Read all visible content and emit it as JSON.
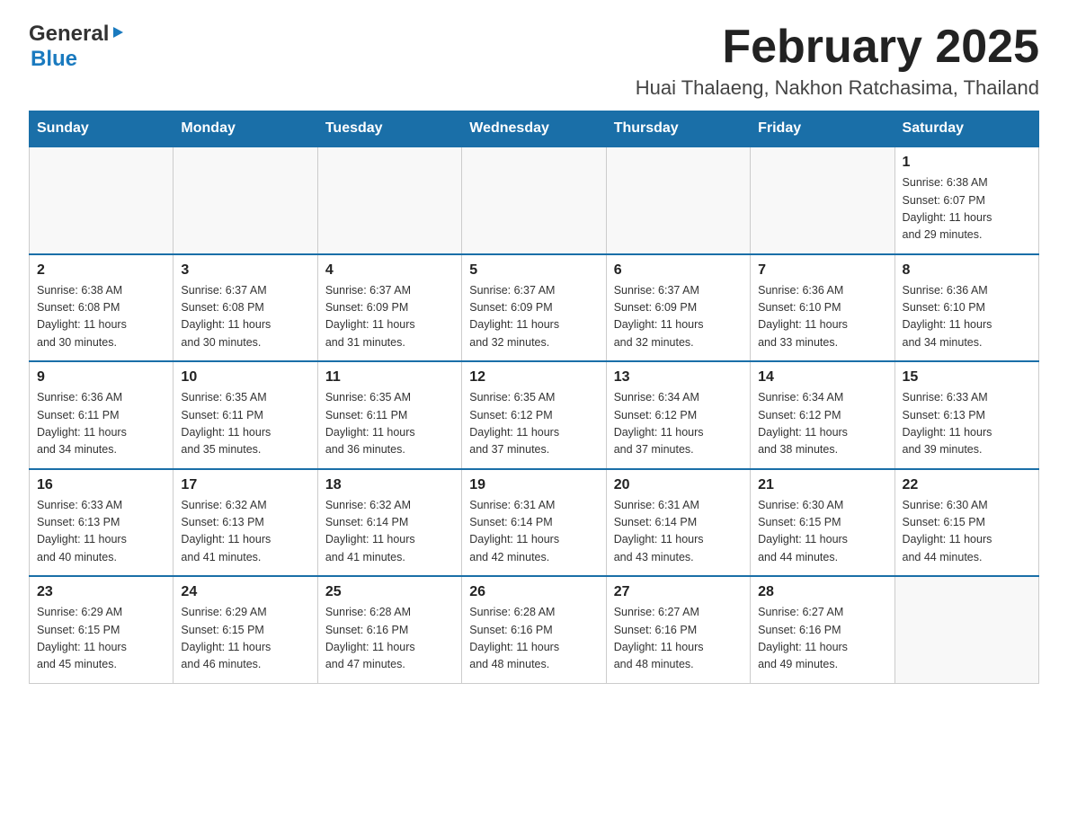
{
  "logo": {
    "general": "General",
    "arrow": "▶",
    "blue": "Blue"
  },
  "header": {
    "title": "February 2025",
    "subtitle": "Huai Thalaeng, Nakhon Ratchasima, Thailand"
  },
  "weekdays": [
    "Sunday",
    "Monday",
    "Tuesday",
    "Wednesday",
    "Thursday",
    "Friday",
    "Saturday"
  ],
  "weeks": [
    [
      {
        "day": "",
        "info": ""
      },
      {
        "day": "",
        "info": ""
      },
      {
        "day": "",
        "info": ""
      },
      {
        "day": "",
        "info": ""
      },
      {
        "day": "",
        "info": ""
      },
      {
        "day": "",
        "info": ""
      },
      {
        "day": "1",
        "info": "Sunrise: 6:38 AM\nSunset: 6:07 PM\nDaylight: 11 hours\nand 29 minutes."
      }
    ],
    [
      {
        "day": "2",
        "info": "Sunrise: 6:38 AM\nSunset: 6:08 PM\nDaylight: 11 hours\nand 30 minutes."
      },
      {
        "day": "3",
        "info": "Sunrise: 6:37 AM\nSunset: 6:08 PM\nDaylight: 11 hours\nand 30 minutes."
      },
      {
        "day": "4",
        "info": "Sunrise: 6:37 AM\nSunset: 6:09 PM\nDaylight: 11 hours\nand 31 minutes."
      },
      {
        "day": "5",
        "info": "Sunrise: 6:37 AM\nSunset: 6:09 PM\nDaylight: 11 hours\nand 32 minutes."
      },
      {
        "day": "6",
        "info": "Sunrise: 6:37 AM\nSunset: 6:09 PM\nDaylight: 11 hours\nand 32 minutes."
      },
      {
        "day": "7",
        "info": "Sunrise: 6:36 AM\nSunset: 6:10 PM\nDaylight: 11 hours\nand 33 minutes."
      },
      {
        "day": "8",
        "info": "Sunrise: 6:36 AM\nSunset: 6:10 PM\nDaylight: 11 hours\nand 34 minutes."
      }
    ],
    [
      {
        "day": "9",
        "info": "Sunrise: 6:36 AM\nSunset: 6:11 PM\nDaylight: 11 hours\nand 34 minutes."
      },
      {
        "day": "10",
        "info": "Sunrise: 6:35 AM\nSunset: 6:11 PM\nDaylight: 11 hours\nand 35 minutes."
      },
      {
        "day": "11",
        "info": "Sunrise: 6:35 AM\nSunset: 6:11 PM\nDaylight: 11 hours\nand 36 minutes."
      },
      {
        "day": "12",
        "info": "Sunrise: 6:35 AM\nSunset: 6:12 PM\nDaylight: 11 hours\nand 37 minutes."
      },
      {
        "day": "13",
        "info": "Sunrise: 6:34 AM\nSunset: 6:12 PM\nDaylight: 11 hours\nand 37 minutes."
      },
      {
        "day": "14",
        "info": "Sunrise: 6:34 AM\nSunset: 6:12 PM\nDaylight: 11 hours\nand 38 minutes."
      },
      {
        "day": "15",
        "info": "Sunrise: 6:33 AM\nSunset: 6:13 PM\nDaylight: 11 hours\nand 39 minutes."
      }
    ],
    [
      {
        "day": "16",
        "info": "Sunrise: 6:33 AM\nSunset: 6:13 PM\nDaylight: 11 hours\nand 40 minutes."
      },
      {
        "day": "17",
        "info": "Sunrise: 6:32 AM\nSunset: 6:13 PM\nDaylight: 11 hours\nand 41 minutes."
      },
      {
        "day": "18",
        "info": "Sunrise: 6:32 AM\nSunset: 6:14 PM\nDaylight: 11 hours\nand 41 minutes."
      },
      {
        "day": "19",
        "info": "Sunrise: 6:31 AM\nSunset: 6:14 PM\nDaylight: 11 hours\nand 42 minutes."
      },
      {
        "day": "20",
        "info": "Sunrise: 6:31 AM\nSunset: 6:14 PM\nDaylight: 11 hours\nand 43 minutes."
      },
      {
        "day": "21",
        "info": "Sunrise: 6:30 AM\nSunset: 6:15 PM\nDaylight: 11 hours\nand 44 minutes."
      },
      {
        "day": "22",
        "info": "Sunrise: 6:30 AM\nSunset: 6:15 PM\nDaylight: 11 hours\nand 44 minutes."
      }
    ],
    [
      {
        "day": "23",
        "info": "Sunrise: 6:29 AM\nSunset: 6:15 PM\nDaylight: 11 hours\nand 45 minutes."
      },
      {
        "day": "24",
        "info": "Sunrise: 6:29 AM\nSunset: 6:15 PM\nDaylight: 11 hours\nand 46 minutes."
      },
      {
        "day": "25",
        "info": "Sunrise: 6:28 AM\nSunset: 6:16 PM\nDaylight: 11 hours\nand 47 minutes."
      },
      {
        "day": "26",
        "info": "Sunrise: 6:28 AM\nSunset: 6:16 PM\nDaylight: 11 hours\nand 48 minutes."
      },
      {
        "day": "27",
        "info": "Sunrise: 6:27 AM\nSunset: 6:16 PM\nDaylight: 11 hours\nand 48 minutes."
      },
      {
        "day": "28",
        "info": "Sunrise: 6:27 AM\nSunset: 6:16 PM\nDaylight: 11 hours\nand 49 minutes."
      },
      {
        "day": "",
        "info": ""
      }
    ]
  ]
}
